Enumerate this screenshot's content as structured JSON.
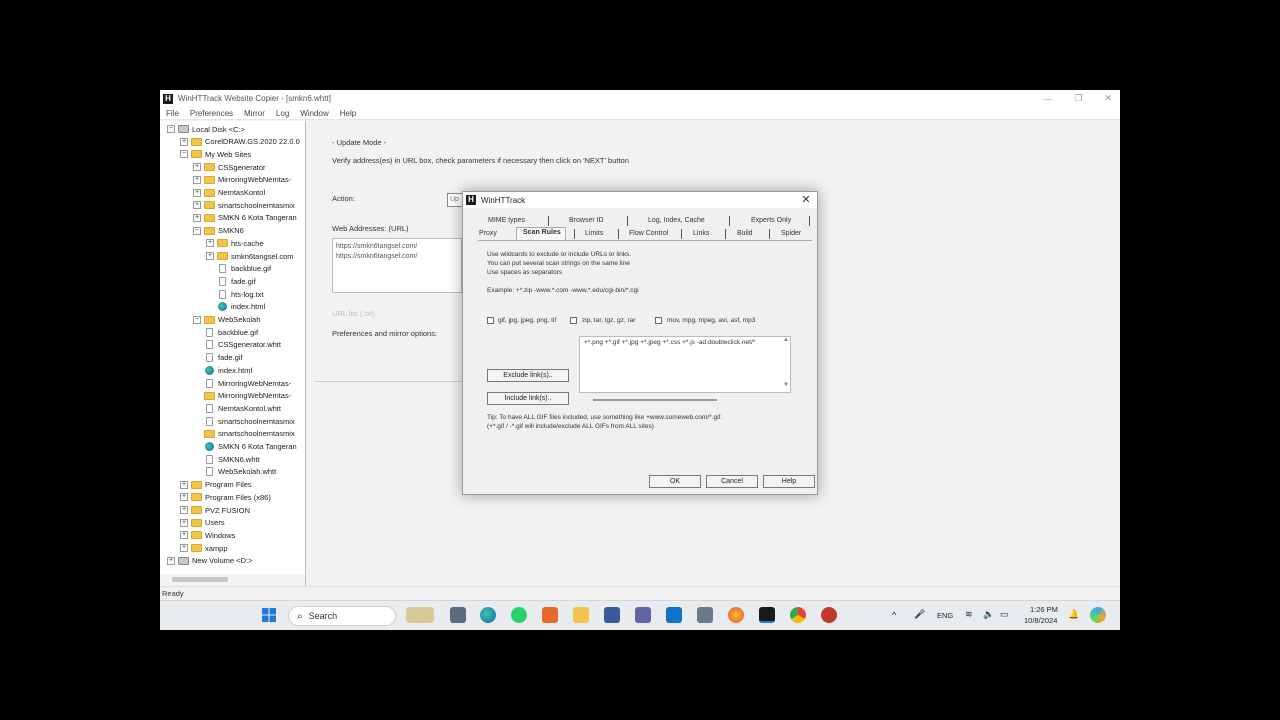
{
  "app": {
    "title": "WinHTTrack Website Copier - [smkn6.whtt]",
    "logo_letter": "H",
    "menu": [
      "File",
      "Preferences",
      "Mirror",
      "Log",
      "Window",
      "Help"
    ]
  },
  "tree": [
    {
      "label": "Local Disk <C:>",
      "icon": "drive-icon",
      "toggle": "−",
      "depth": 0
    },
    {
      "label": "CorelDRAW.GS.2020 22.0.0",
      "icon": "folder-icon",
      "toggle": "+",
      "depth": 1
    },
    {
      "label": "My Web Sites",
      "icon": "folder-icon",
      "toggle": "−",
      "depth": 1
    },
    {
      "label": "CSSgenerator",
      "icon": "folder-icon",
      "toggle": "+",
      "depth": 2
    },
    {
      "label": "MirroringWebNemtas-",
      "icon": "folder-icon",
      "toggle": "+",
      "depth": 2
    },
    {
      "label": "NemtasKontol",
      "icon": "folder-icon",
      "toggle": "+",
      "depth": 2
    },
    {
      "label": "smartschoolnemtasmix",
      "icon": "folder-icon",
      "toggle": "+",
      "depth": 2
    },
    {
      "label": "SMKN 6 Kota Tangeran",
      "icon": "folder-icon",
      "toggle": "+",
      "depth": 2
    },
    {
      "label": "SMKN6",
      "icon": "folder-icon",
      "toggle": "−",
      "depth": 2
    },
    {
      "label": "hts-cache",
      "icon": "folder-icon",
      "toggle": "+",
      "depth": 3
    },
    {
      "label": "smkn6tangsel.com",
      "icon": "folder-icon",
      "toggle": "+",
      "depth": 3
    },
    {
      "label": "backblue.gif",
      "icon": "file-icon",
      "toggle": "",
      "depth": 3
    },
    {
      "label": "fade.gif",
      "icon": "file-icon",
      "toggle": "",
      "depth": 3
    },
    {
      "label": "hts-log.txt",
      "icon": "file-icon",
      "toggle": "",
      "depth": 3
    },
    {
      "label": "index.html",
      "icon": "edge-icon",
      "toggle": "",
      "depth": 3
    },
    {
      "label": "WebSekolah",
      "icon": "folder-icon",
      "toggle": "−",
      "depth": 2
    },
    {
      "label": "backblue.gif",
      "icon": "file-icon",
      "toggle": "",
      "depth": 2
    },
    {
      "label": "CSSgenerator.whtt",
      "icon": "file-icon",
      "toggle": "",
      "depth": 2
    },
    {
      "label": "fade.gif",
      "icon": "file-icon",
      "toggle": "",
      "depth": 2
    },
    {
      "label": "index.html",
      "icon": "edge-icon",
      "toggle": "",
      "depth": 2
    },
    {
      "label": "MirroringWebNemtas-",
      "icon": "file-icon",
      "toggle": "",
      "depth": 2
    },
    {
      "label": "MirroringWebNemtas-",
      "icon": "folder-icon",
      "toggle": "",
      "depth": 2
    },
    {
      "label": "NemtasKontol.whtt",
      "icon": "file-icon",
      "toggle": "",
      "depth": 2
    },
    {
      "label": "smartschoolnemtasmix",
      "icon": "file-icon",
      "toggle": "",
      "depth": 2
    },
    {
      "label": "smartschoolnemtasmix",
      "icon": "folder-icon",
      "toggle": "",
      "depth": 2
    },
    {
      "label": "SMKN 6 Kota Tangeran",
      "icon": "edge-icon",
      "toggle": "",
      "depth": 2
    },
    {
      "label": "SMKN6.whtt",
      "icon": "file-icon",
      "toggle": "",
      "depth": 2
    },
    {
      "label": "WebSekolah.whtt",
      "icon": "file-icon",
      "toggle": "",
      "depth": 2
    },
    {
      "label": "Program Files",
      "icon": "folder-icon",
      "toggle": "+",
      "depth": 1
    },
    {
      "label": "Program Files (x86)",
      "icon": "folder-icon",
      "toggle": "+",
      "depth": 1
    },
    {
      "label": "PVZ FUSION",
      "icon": "folder-icon",
      "toggle": "+",
      "depth": 1
    },
    {
      "label": "Users",
      "icon": "folder-icon",
      "toggle": "+",
      "depth": 1
    },
    {
      "label": "Windows",
      "icon": "folder-icon",
      "toggle": "+",
      "depth": 1
    },
    {
      "label": "xampp",
      "icon": "folder-icon",
      "toggle": "+",
      "depth": 1
    },
    {
      "label": "New Volume <D:>",
      "icon": "drive-icon",
      "toggle": "+",
      "depth": 0
    }
  ],
  "panel": {
    "mode": "- Update Mode -",
    "instructions": "Verify address(es) in URL box, check parameters if necessary then click on 'NEXT' button",
    "action_label": "Action:",
    "action_value": "Up",
    "web_addresses_label": "Web Addresses: (URL)",
    "urls": [
      "https://smkn6tangsel.com/",
      "https://smkn6tangsel.com/"
    ],
    "url_list_label": "URL list (.txt)",
    "prefs_label": "Preferences and mirror options:"
  },
  "status": "Ready",
  "dialog": {
    "title": "WinHTTrack",
    "tabs_row1": [
      "MIME types",
      "Browser ID",
      "Log, Index, Cache",
      "Experts Only"
    ],
    "tabs_row2": [
      "Proxy",
      "Scan Rules",
      "Limits",
      "Flow Control",
      "Links",
      "Build",
      "Spider"
    ],
    "active_tab": "Scan Rules",
    "help_lines": [
      "Use wildcards to exclude or include URLs or links.",
      "You can put several scan strings on the same line",
      "Use spaces as separators"
    ],
    "example": "Example: +*.zip -www.*.com -www.*.edu/cgi-bin/*.cgi",
    "checkboxes": [
      "gif, jpg, jpeg, png, tif",
      "zip, tar, tgz, gz, rar",
      "mov, mpg, mpeg, avi, asf, mp3"
    ],
    "filter_text": "+*.png +*.gif +*.jpg +*.jpeg +*.css +*.js -ad.doubleclick.net/*",
    "exclude_button": "Exclude link(s)..",
    "include_button": "Include link(s)..",
    "tip_lines": [
      "Tip: To have ALL GIF files included, use something like +www.someweb.com/*.gif.",
      "(+*.gif / -*.gif will include/exclude ALL GIFs from ALL sites)"
    ],
    "ok": "OK",
    "cancel": "Cancel",
    "help": "Help"
  },
  "taskbar": {
    "search_placeholder": "Search",
    "language": "ENG",
    "time": "1:26 PM",
    "date": "10/8/2024"
  }
}
